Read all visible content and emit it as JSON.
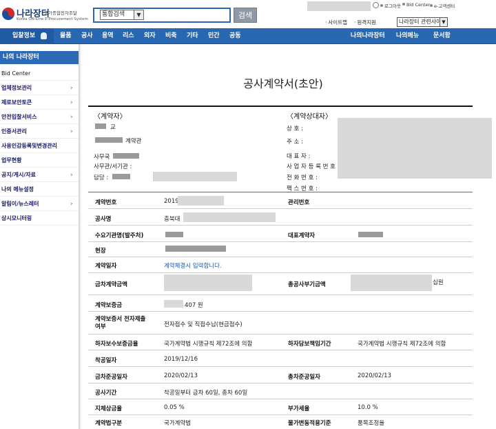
{
  "header": {
    "brand_name": "나라장터",
    "brand_sub": "국가종합전자조달",
    "tagline": "Korea ON-Line E-Procurement System",
    "search_select": "통합검색",
    "search_button": "검색",
    "top_links": [
      "로그아웃",
      "Bid Center",
      "e-고객센터"
    ],
    "sitemap_label": "사이트맵",
    "remote_label": "원격지원",
    "related_select": "나라장터 관련사이트"
  },
  "nav": {
    "items": [
      "입찰정보",
      "물품",
      "공사",
      "용역",
      "리스",
      "외자",
      "비축",
      "기타",
      "민간",
      "공동"
    ],
    "right_items": [
      "나의나라장터",
      "나의메뉴",
      "문서함"
    ]
  },
  "sidebar": {
    "title": "나의 나라장터",
    "items": [
      "Bid Center",
      "업체정보관리",
      "제로보안토큰",
      "안전입찰서비스",
      "인증서관리",
      "사용인감등록및변경관리",
      "업무현황",
      "공지/게시/자료",
      "나의 메뉴설정",
      "알림이/뉴스레터",
      "상시모니터링"
    ]
  },
  "document": {
    "title": "공사계약서(초안)",
    "contractor_head": "〈계약자〉",
    "counterparty_head": "〈계약상대자〉",
    "contractor": {
      "agency_suffix": "교",
      "officer_suffix": "계약관",
      "office_label": "사무국",
      "secretary_label": "사무관/서기관 :",
      "manager_label": "담당 :"
    },
    "counterparty_labels": [
      "상 호 :",
      "주 소 :",
      "대 표 자 :",
      "사 업 자 등 록 번 호 :",
      "전 화 번 호 :",
      "팩 스 번 호 :"
    ],
    "rows": [
      {
        "label": "계약번호",
        "value": "2019",
        "label2": "관리번호",
        "value2": ""
      },
      {
        "label": "공사명",
        "value": "충북대",
        "label2": "",
        "value2": ""
      },
      {
        "label": "수요기관명(발주처)",
        "value": "",
        "label2": "대표계약자",
        "value2": ""
      },
      {
        "label": "현장",
        "value": "",
        "label2": "",
        "value2": ""
      },
      {
        "label": "계약일자",
        "value": "계약체결시 입력합니다.",
        "label2": "",
        "value2": ""
      },
      {
        "label": "금차계약금액",
        "value": "",
        "label2": "총공사부기금액",
        "value2": "십원"
      },
      {
        "label": "계약보증금",
        "value": "407 원",
        "label2": "",
        "value2": ""
      },
      {
        "label": "계약보증서 전자제출여부",
        "value": "전자접수 및 직접수납(현금접수)",
        "label2": "",
        "value2": ""
      },
      {
        "label": "하자보수보증금율",
        "value": "국가계약법 시행규칙 제72조에 의함",
        "label2": "하자담보책임기간",
        "value2": "국가계약법 시행규칙 제72조에 의함"
      },
      {
        "label": "착공일자",
        "value": "2019/12/16",
        "label2": "",
        "value2": ""
      },
      {
        "label": "금차준공일자",
        "value": "2020/02/13",
        "label2": "총차준공일자",
        "value2": "2020/02/13"
      },
      {
        "label": "공사기간",
        "value": "착공일부터  금차 60일,   총차 60일",
        "label2": "",
        "value2": ""
      },
      {
        "label": "지체상금율",
        "value": "0.05 %",
        "label2": "부가세율",
        "value2": "10.0 %"
      },
      {
        "label": "계약법구분",
        "value": "국가계약법",
        "label2": "물가변동적용기준",
        "value2": "품목조정율"
      }
    ]
  }
}
